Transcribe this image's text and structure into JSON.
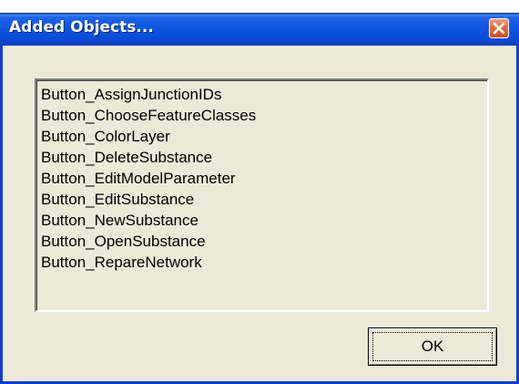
{
  "window": {
    "title": "Added Objects...",
    "close_icon": "close-icon",
    "accent_color": "#0d55e2",
    "close_color": "#e36a3f"
  },
  "list": {
    "items": [
      "Button_AssignJunctionIDs",
      "Button_ChooseFeatureClasses",
      "Button_ColorLayer",
      "Button_DeleteSubstance",
      "Button_EditModelParameter",
      "Button_EditSubstance",
      "Button_NewSubstance",
      "Button_OpenSubstance",
      "Button_RepareNetwork"
    ]
  },
  "buttons": {
    "ok_label": "OK"
  }
}
